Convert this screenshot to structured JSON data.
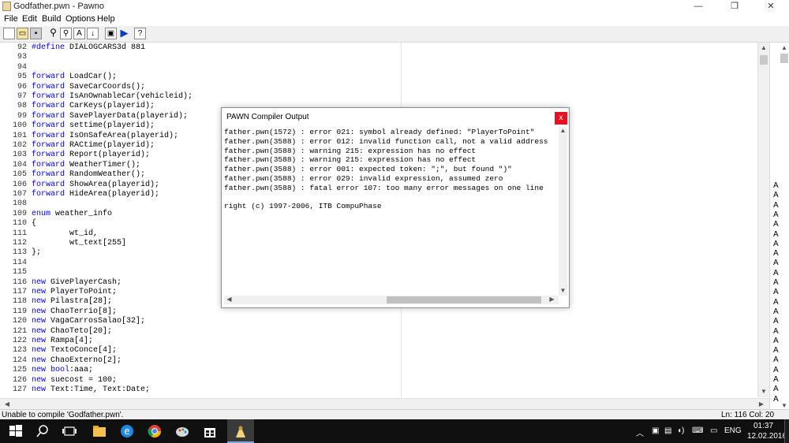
{
  "window": {
    "title": "Godfather.pwn - Pawno",
    "minimize": "—",
    "maximize": "❐",
    "close": "✕"
  },
  "menu": [
    "File",
    "Edit",
    "Build",
    "Options",
    "Help"
  ],
  "toolbar": [
    "new-file",
    "open-file",
    "save-file",
    "find",
    "find-next",
    "replace",
    "go-to",
    "compile",
    "run",
    "help"
  ],
  "code": [
    {
      "n": "92",
      "t": "#define DIALOGCARS3d 881"
    },
    {
      "n": "93",
      "t": ""
    },
    {
      "n": "94",
      "t": ""
    },
    {
      "n": "95",
      "t": "forward LoadCar();"
    },
    {
      "n": "96",
      "t": "forward SaveCarCoords();"
    },
    {
      "n": "97",
      "t": "forward IsAnOwnableCar(vehicleid);"
    },
    {
      "n": "98",
      "t": "forward CarKeys(playerid);"
    },
    {
      "n": "99",
      "t": "forward SavePlayerData(playerid);"
    },
    {
      "n": "100",
      "t": "forward settime(playerid);"
    },
    {
      "n": "101",
      "t": "forward IsOnSafeArea(playerid);"
    },
    {
      "n": "102",
      "t": "forward RACtime(playerid);"
    },
    {
      "n": "103",
      "t": "forward Report(playerid);"
    },
    {
      "n": "104",
      "t": "forward WeatherTimer();"
    },
    {
      "n": "105",
      "t": "forward RandomWeather();"
    },
    {
      "n": "106",
      "t": "forward ShowArea(playerid);"
    },
    {
      "n": "107",
      "t": "forward HideArea(playerid);"
    },
    {
      "n": "108",
      "t": ""
    },
    {
      "n": "109",
      "t": "enum weather_info"
    },
    {
      "n": "110",
      "t": "{"
    },
    {
      "n": "111",
      "t": "        wt_id,"
    },
    {
      "n": "112",
      "t": "        wt_text[255]"
    },
    {
      "n": "113",
      "t": "};"
    },
    {
      "n": "114",
      "t": ""
    },
    {
      "n": "115",
      "t": ""
    },
    {
      "n": "116",
      "t": "new GivePlayerCash;"
    },
    {
      "n": "117",
      "t": "new PlayerToPoint;"
    },
    {
      "n": "118",
      "t": "new Pilastra[28];"
    },
    {
      "n": "119",
      "t": "new ChaoTerrio[8];"
    },
    {
      "n": "120",
      "t": "new VagaCarrosSalao[32];"
    },
    {
      "n": "121",
      "t": "new ChaoTeto[20];"
    },
    {
      "n": "122",
      "t": "new Rampa[4];"
    },
    {
      "n": "123",
      "t": "new TextoConce[4];"
    },
    {
      "n": "124",
      "t": "new ChaoExterno[2];"
    },
    {
      "n": "125",
      "t": "new bool:aaa;"
    },
    {
      "n": "126",
      "t": "new suecost = 100;"
    },
    {
      "n": "127",
      "t": "new Text:Time, Text:Date;"
    }
  ],
  "side_column": {
    "letter": "A",
    "count": 23
  },
  "dialog": {
    "title": "PAWN Compiler Output",
    "close": "x",
    "lines": [
      "father.pwn(1572) : error 021: symbol already defined: \"PlayerToPoint\"",
      "father.pwn(3588) : error 012: invalid function call, not a valid address",
      "father.pwn(3588) : warning 215: expression has no effect",
      "father.pwn(3588) : warning 215: expression has no effect",
      "father.pwn(3588) : error 001: expected token: \";\", but found \")\"",
      "father.pwn(3588) : error 029: invalid expression, assumed zero",
      "father.pwn(3588) : fatal error 107: too many error messages on one line",
      "",
      "right (c) 1997-2006, ITB CompuPhase"
    ]
  },
  "status": {
    "message": "Unable to compile 'Godfather.pwn'.",
    "position": "Ln: 116  Col: 20"
  },
  "taskbar": {
    "language": "ENG",
    "time": "01:37",
    "date": "12.02.2016"
  }
}
